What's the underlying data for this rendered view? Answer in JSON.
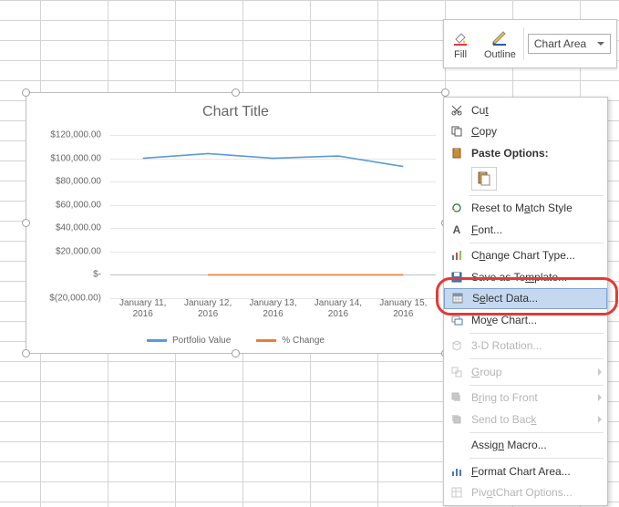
{
  "toolbar": {
    "fill_label": "Fill",
    "outline_label": "Outline",
    "chart_area_label": "Chart Area"
  },
  "chart_data": {
    "type": "line",
    "title": "Chart Title",
    "categories": [
      "January 11, 2016",
      "January 12, 2016",
      "January 13, 2016",
      "January 14, 2016",
      "January 15, 2016"
    ],
    "series": [
      {
        "name": "Portfolio Value",
        "values": [
          100000,
          104000,
          100000,
          102000,
          93000
        ],
        "color": "#5b9bd5"
      },
      {
        "name": "% Change",
        "values": [
          0,
          0,
          0,
          0,
          0
        ],
        "color": "#ed7d31"
      }
    ],
    "ylim": [
      -20000,
      120000
    ],
    "y_ticks": [
      "$120,000.00",
      "$100,000.00",
      "$80,000.00",
      "$60,000.00",
      "$40,000.00",
      "$20,000.00",
      "$-",
      "$(20,000.00)"
    ],
    "xlabel": "",
    "ylabel": ""
  },
  "context_menu": {
    "cut": "Cut",
    "copy": "Copy",
    "paste_options": "Paste Options:",
    "reset": "Reset to Match Style",
    "font": "Font...",
    "change_type": "Change Chart Type...",
    "save_template": "Save as Template...",
    "select_data": "Select Data...",
    "move_chart": "Move Chart...",
    "rotation": "3-D Rotation...",
    "group": "Group",
    "bring_front": "Bring to Front",
    "send_back": "Send to Back",
    "assign_macro": "Assign Macro...",
    "format_chart": "Format Chart Area...",
    "pivot_options": "PivotChart Options..."
  },
  "colors": {
    "series1": "#5b9bd5",
    "series2": "#ed7d31"
  }
}
